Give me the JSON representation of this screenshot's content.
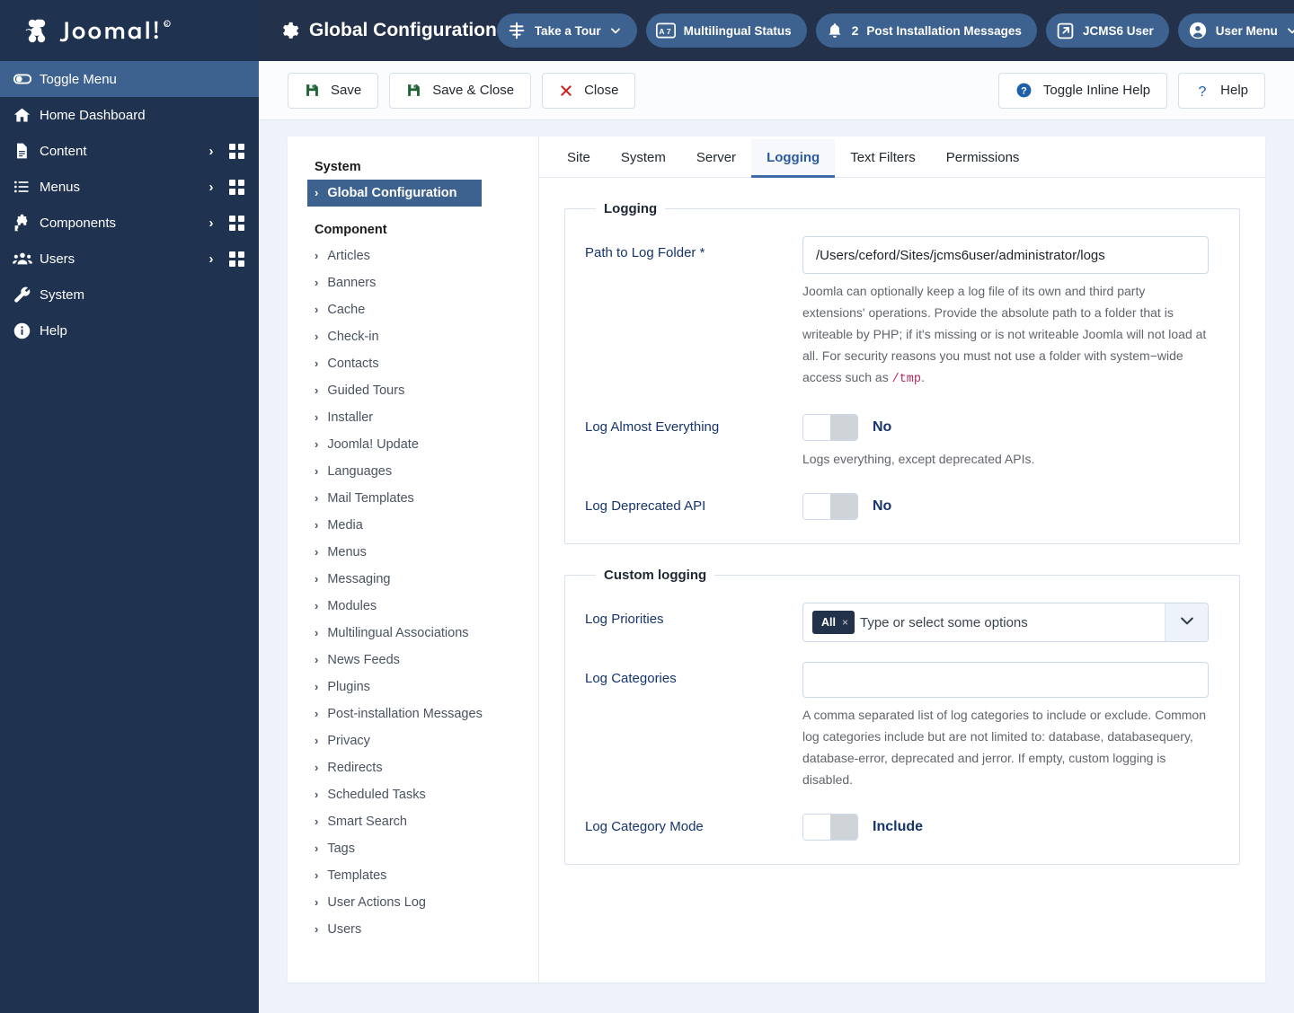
{
  "brand": {
    "name": "Joomla!",
    "logo_icon": "joomla-logo"
  },
  "sidebar": {
    "items": [
      {
        "label": "Toggle Menu",
        "icon": "toggle-icon",
        "active": true,
        "chevron": false,
        "grid": false
      },
      {
        "label": "Home Dashboard",
        "icon": "home-icon",
        "active": false,
        "chevron": false,
        "grid": false
      },
      {
        "label": "Content",
        "icon": "document-icon",
        "active": false,
        "chevron": true,
        "grid": true
      },
      {
        "label": "Menus",
        "icon": "list-icon",
        "active": false,
        "chevron": true,
        "grid": true
      },
      {
        "label": "Components",
        "icon": "puzzle-icon",
        "active": false,
        "chevron": true,
        "grid": true
      },
      {
        "label": "Users",
        "icon": "users-icon",
        "active": false,
        "chevron": true,
        "grid": true
      },
      {
        "label": "System",
        "icon": "wrench-icon",
        "active": false,
        "chevron": false,
        "grid": false
      },
      {
        "label": "Help",
        "icon": "info-icon",
        "active": false,
        "chevron": false,
        "grid": false
      }
    ]
  },
  "header": {
    "title": "Global Configuration",
    "title_icon": "gear-icon",
    "actions": [
      {
        "label": "Take a Tour",
        "icon": "signpost-icon",
        "chevron": true,
        "count": ""
      },
      {
        "label": "Multilingual Status",
        "icon": "translate-icon",
        "chevron": false,
        "count": ""
      },
      {
        "label": "Post Installation Messages",
        "icon": "bell-icon",
        "chevron": false,
        "count": "2"
      },
      {
        "label": "JCMS6 User",
        "icon": "external-link-icon",
        "chevron": false,
        "count": ""
      },
      {
        "label": "User Menu",
        "icon": "user-circle-icon",
        "chevron": true,
        "count": ""
      }
    ],
    "kebab_icon": "options-icon"
  },
  "toolbar": {
    "save_label": "Save",
    "save_close_label": "Save & Close",
    "close_label": "Close",
    "toggle_inline_help_label": "Toggle Inline Help",
    "help_label": "Help"
  },
  "config_list": {
    "system_heading": "System",
    "system_items": [
      "Global Configuration"
    ],
    "active_item": "Global Configuration",
    "component_heading": "Component",
    "component_items": [
      "Articles",
      "Banners",
      "Cache",
      "Check-in",
      "Contacts",
      "Guided Tours",
      "Installer",
      "Joomla! Update",
      "Languages",
      "Mail Templates",
      "Media",
      "Menus",
      "Messaging",
      "Modules",
      "Multilingual Associations",
      "News Feeds",
      "Plugins",
      "Post-installation Messages",
      "Privacy",
      "Redirects",
      "Scheduled Tasks",
      "Smart Search",
      "Tags",
      "Templates",
      "User Actions Log",
      "Users"
    ]
  },
  "tabs": [
    {
      "label": "Site",
      "active": false
    },
    {
      "label": "System",
      "active": false
    },
    {
      "label": "Server",
      "active": false
    },
    {
      "label": "Logging",
      "active": true
    },
    {
      "label": "Text Filters",
      "active": false
    },
    {
      "label": "Permissions",
      "active": false
    }
  ],
  "logging": {
    "legend": "Logging",
    "path_label": "Path to Log Folder *",
    "path_value": "/Users/ceford/Sites/jcms6user/administrator/logs",
    "path_help_before": "Joomla can optionally keep a log file of its own and third party extensions' operations. Provide the absolute path to a folder that is writeable by PHP; if it's missing or is not writeable Joomla will not load at all. For security reasons you must not use a folder with system−wide access such as ",
    "path_help_code": "/tmp",
    "path_help_after": ".",
    "log_everything_label": "Log Almost Everything",
    "log_everything_value": "No",
    "log_everything_help": "Logs everything, except deprecated APIs.",
    "log_deprecated_label": "Log Deprecated API",
    "log_deprecated_value": "No"
  },
  "custom_logging": {
    "legend": "Custom logging",
    "priorities_label": "Log Priorities",
    "priorities_chip": "All",
    "priorities_chip_remove": "×",
    "priorities_placeholder": "Type or select some options",
    "categories_label": "Log Categories",
    "categories_value": "",
    "categories_help": "A comma separated list of log categories to include or exclude. Common log categories include but are not limited to: database, databasequery, database-error, deprecated and jerror. If empty, custom logging is disabled.",
    "category_mode_label": "Log Category Mode",
    "category_mode_value": "Include"
  },
  "colors": {
    "sidebar_bg": "#1f3350",
    "header_bg": "#23324a",
    "accent_blue": "#3d628f",
    "page_bg": "#eef2fa",
    "label_blue": "#17356b",
    "save_green": "#1d6335",
    "close_red": "#d01b1b"
  }
}
